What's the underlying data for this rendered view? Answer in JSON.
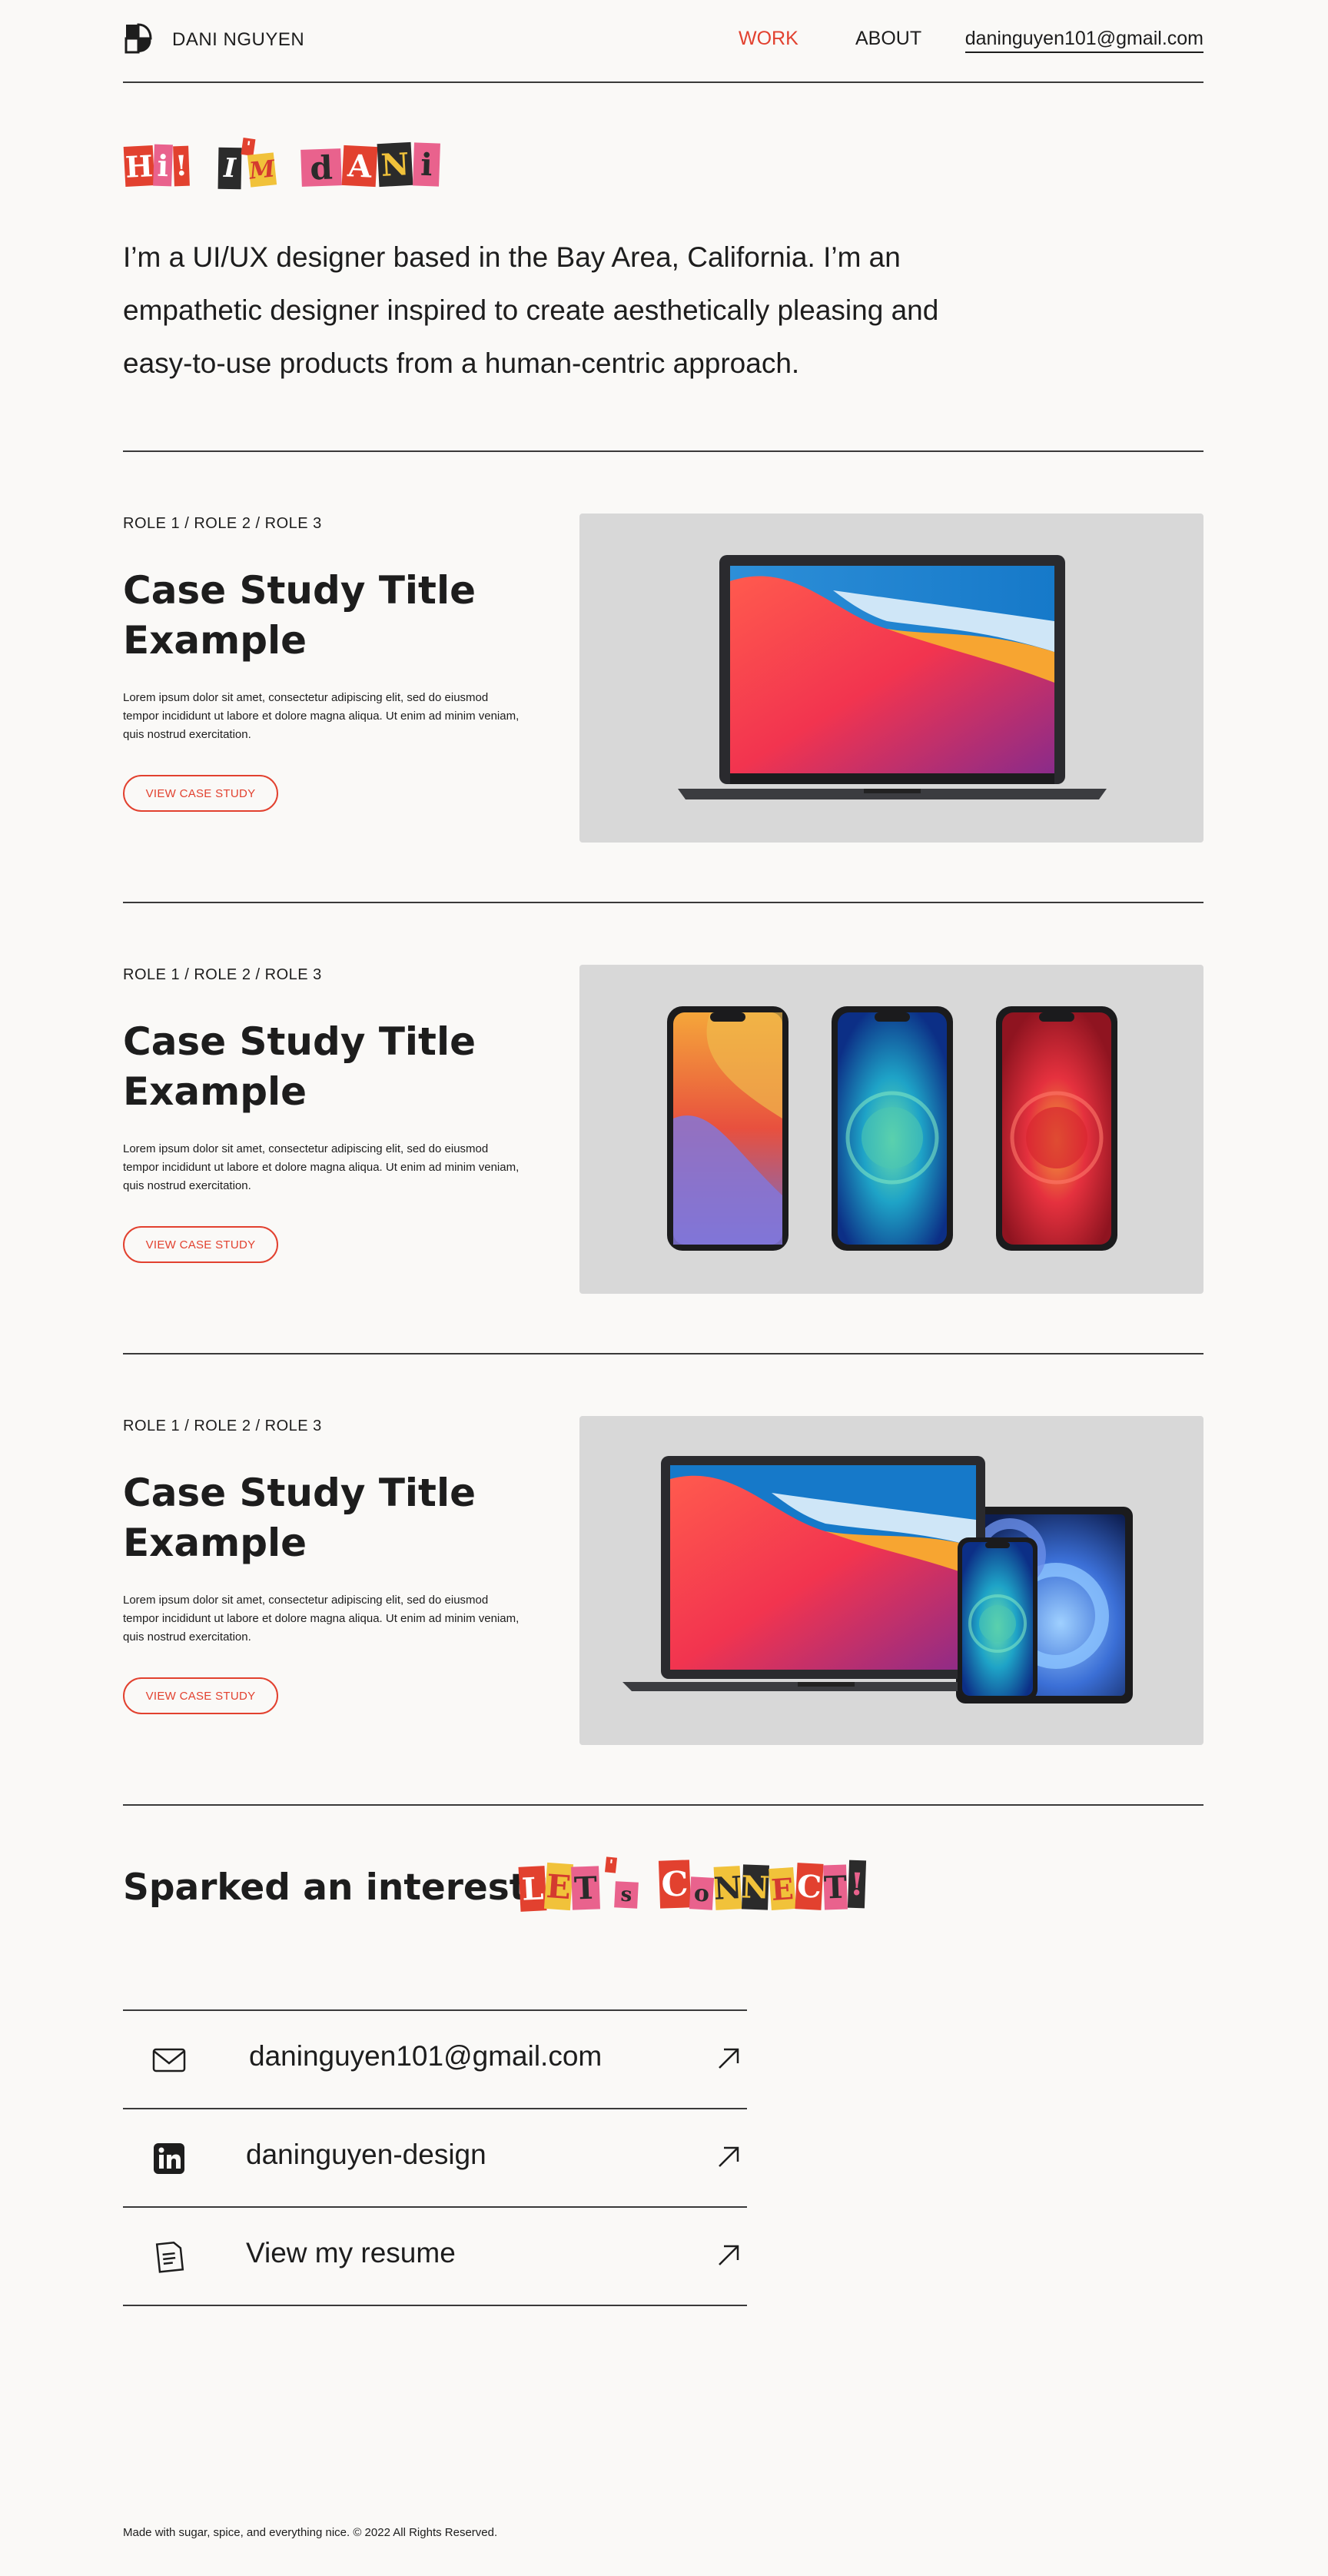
{
  "header": {
    "brand": "DANI NGUYEN",
    "nav": {
      "work": "WORK",
      "about": "ABOUT",
      "email": "daninguyen101@gmail.com"
    }
  },
  "hero": {
    "greeting_letters": [
      "H",
      "i",
      "!",
      "I",
      "'",
      "M",
      "d",
      "A",
      "N",
      "i"
    ],
    "intro": "I’m a UI/UX designer based in the Bay Area, California. I’m an empathetic designer inspired to create aesthetically pleasing and easy-to-use products from a human-centric approach."
  },
  "case_studies": [
    {
      "roles": "ROLE 1 / ROLE 2 / ROLE 3",
      "title": "Case Study Title Example",
      "description": "Lorem ipsum dolor sit amet, consectetur adipiscing elit, sed do eiusmod tempor incididunt ut labore et dolore magna aliqua. Ut enim ad minim veniam, quis nostrud exercitation.",
      "button": "VIEW CASE STUDY",
      "image": "laptop"
    },
    {
      "roles": "ROLE 1 / ROLE 2 / ROLE 3",
      "title": "Case Study Title Example",
      "description": "Lorem ipsum dolor sit amet, consectetur adipiscing elit, sed do eiusmod tempor incididunt ut labore et dolore magna aliqua. Ut enim ad minim veniam, quis nostrud exercitation.",
      "button": "VIEW CASE STUDY",
      "image": "three-phones"
    },
    {
      "roles": "ROLE 1 / ROLE 2 / ROLE 3",
      "title": "Case Study Title Example",
      "description": "Lorem ipsum dolor sit amet, consectetur adipiscing elit, sed do eiusmod tempor incididunt ut labore et dolore magna aliqua. Ut enim ad minim veniam, quis nostrud exercitation.",
      "button": "VIEW CASE STUDY",
      "image": "laptop-tablet-phone"
    }
  ],
  "connect": {
    "heading": "Sparked an interest?",
    "art_letters": [
      "L",
      "E",
      "T",
      "'",
      "s",
      "C",
      "o",
      "N",
      "N",
      "E",
      "C",
      "T",
      "!"
    ],
    "links": [
      {
        "icon": "mail-icon",
        "text": "daninguyen101@gmail.com"
      },
      {
        "icon": "linkedin-icon",
        "text": "daninguyen-design"
      },
      {
        "icon": "resume-icon",
        "text": "View my resume"
      }
    ]
  },
  "footer": {
    "text": "Made with sugar, spice, and everything nice. © 2022 All Rights Reserved."
  },
  "colors": {
    "accent": "#e2412f",
    "background": "#faf9f7",
    "panel": "#d8d8d8",
    "text": "#1d1d1d"
  }
}
